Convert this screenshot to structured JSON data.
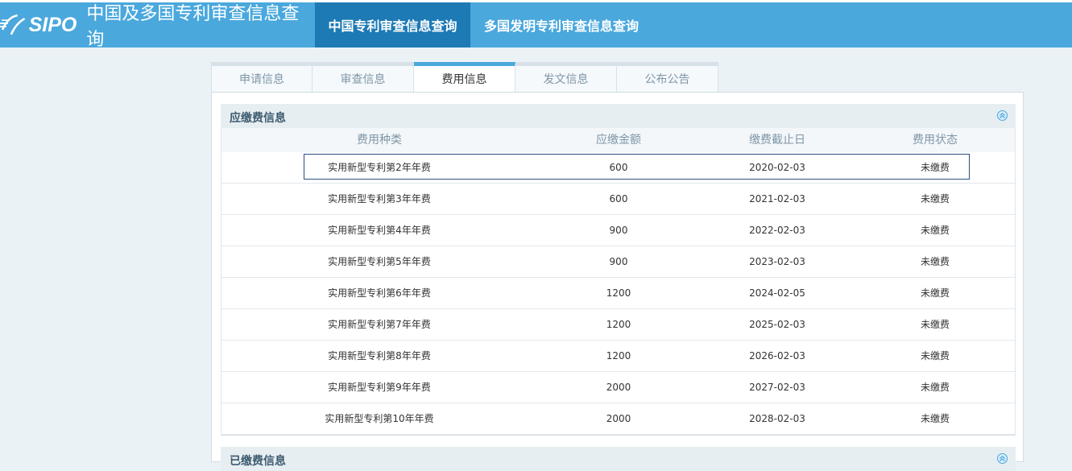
{
  "header": {
    "logo_text": "SIPO",
    "site_title": "中国及多国专利审查信息查询",
    "nav": [
      {
        "label": "中国专利审查信息查询",
        "active": true
      },
      {
        "label": "多国发明专利审查信息查询",
        "active": false
      }
    ]
  },
  "tabs": [
    {
      "label": "申请信息",
      "active": false
    },
    {
      "label": "审查信息",
      "active": false
    },
    {
      "label": "费用信息",
      "active": true
    },
    {
      "label": "发文信息",
      "active": false
    },
    {
      "label": "公布公告",
      "active": false
    }
  ],
  "due_fees": {
    "title": "应缴费信息",
    "columns": [
      "费用种类",
      "应缴金额",
      "缴费截止日",
      "费用状态"
    ],
    "rows": [
      [
        "实用新型专利第2年年费",
        "600",
        "2020-02-03",
        "未缴费"
      ],
      [
        "实用新型专利第3年年费",
        "600",
        "2021-02-03",
        "未缴费"
      ],
      [
        "实用新型专利第4年年费",
        "900",
        "2022-02-03",
        "未缴费"
      ],
      [
        "实用新型专利第5年年费",
        "900",
        "2023-02-03",
        "未缴费"
      ],
      [
        "实用新型专利第6年年费",
        "1200",
        "2024-02-05",
        "未缴费"
      ],
      [
        "实用新型专利第7年年费",
        "1200",
        "2025-02-03",
        "未缴费"
      ],
      [
        "实用新型专利第8年年费",
        "1200",
        "2026-02-03",
        "未缴费"
      ],
      [
        "实用新型专利第9年年费",
        "2000",
        "2027-02-03",
        "未缴费"
      ],
      [
        "实用新型专利第10年年费",
        "2000",
        "2028-02-03",
        "未缴费"
      ]
    ]
  },
  "paid_fees": {
    "title": "已缴费信息"
  },
  "colors": {
    "header_bg": "#4aa8dd",
    "nav_active_bg": "#1d7ab5",
    "page_bg": "#ebf2f5"
  }
}
